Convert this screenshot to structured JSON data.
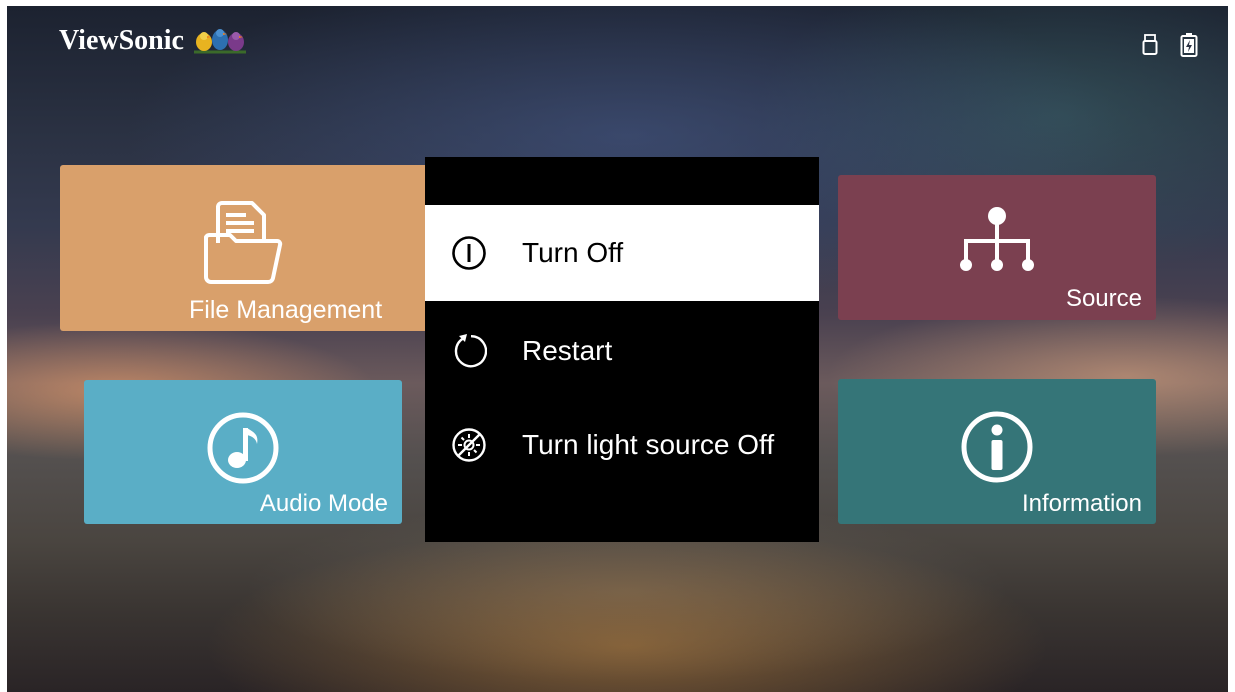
{
  "brand": {
    "name": "ViewSonic"
  },
  "status_bar": {
    "icons": [
      "usb-storage-icon",
      "battery-charging-icon"
    ]
  },
  "tiles": {
    "file_management": {
      "label": "File Management",
      "icon": "folder-documents-icon",
      "color": "#d9a06b"
    },
    "audio_mode": {
      "label": "Audio Mode",
      "icon": "music-note-icon",
      "color": "#5aaec6"
    },
    "source": {
      "label": "Source",
      "icon": "source-tree-icon",
      "color": "#7b4050"
    },
    "information": {
      "label": "Information",
      "icon": "info-icon",
      "color": "#357578"
    }
  },
  "power_menu": {
    "selected": "Turn Off",
    "items": [
      {
        "label": "Turn Off",
        "icon": "power-icon"
      },
      {
        "label": "Restart",
        "icon": "restart-icon"
      },
      {
        "label": "Turn light source Off",
        "icon": "light-off-icon"
      }
    ]
  }
}
